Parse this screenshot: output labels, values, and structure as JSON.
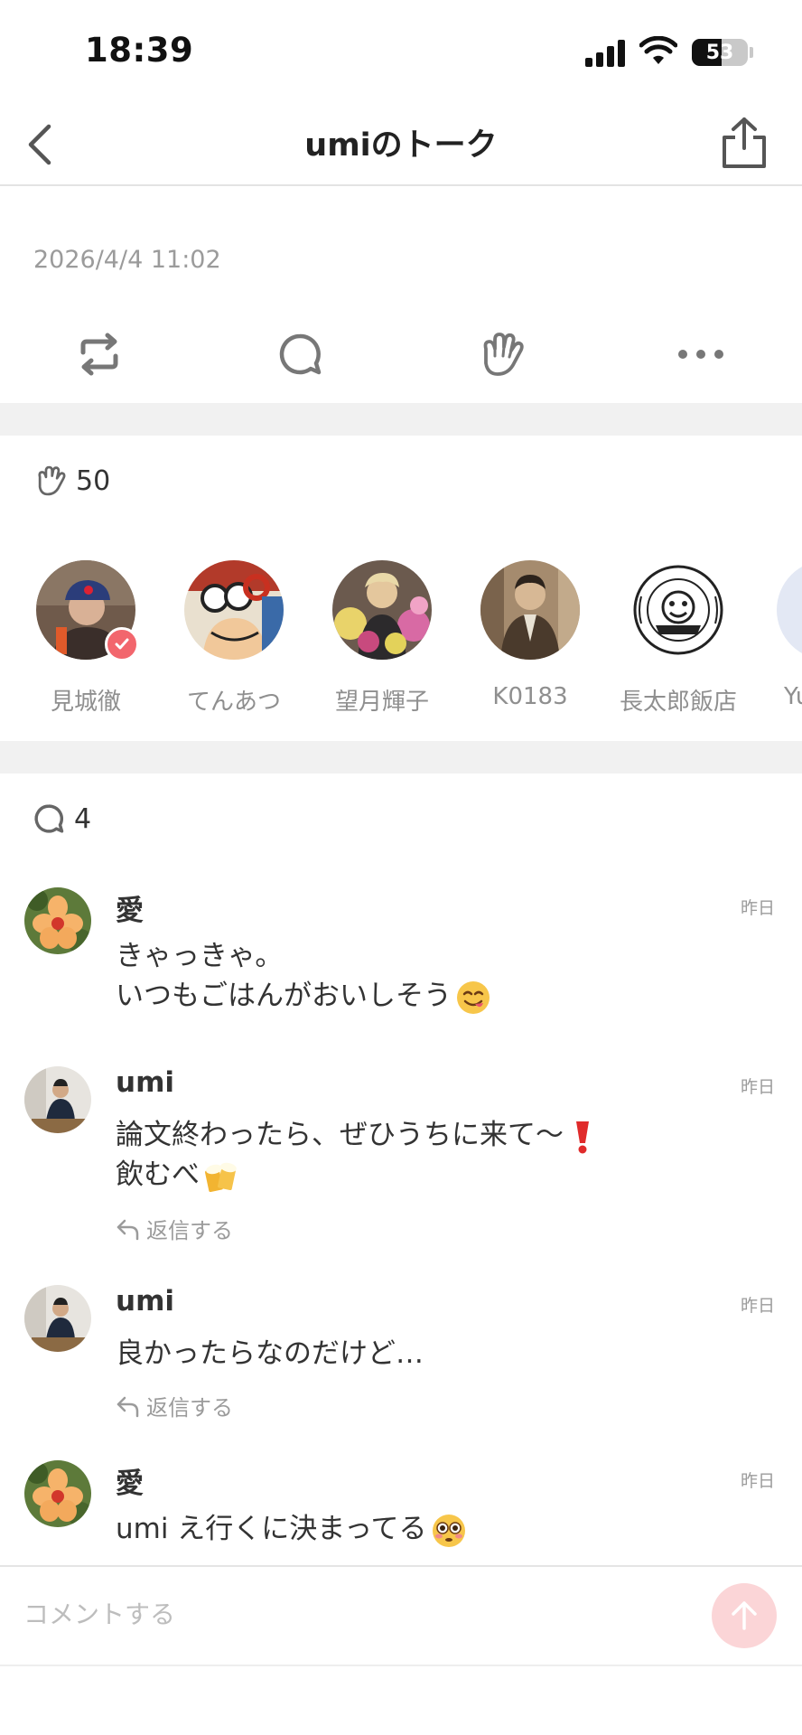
{
  "status_bar": {
    "time": "18:39",
    "battery": "53",
    "battery_level": 0.53
  },
  "header": {
    "title": "umiのトーク"
  },
  "post": {
    "date": "2026/4/4 11:02"
  },
  "claps": {
    "count": "50",
    "users": [
      {
        "name": "見城徹",
        "verified": true
      },
      {
        "name": "てんあつ"
      },
      {
        "name": "望月輝子"
      },
      {
        "name": "K0183"
      },
      {
        "name": "長太郎飯店"
      },
      {
        "name": "Yu"
      }
    ]
  },
  "comments": {
    "count": "4",
    "reply_label": "返信する",
    "items": [
      {
        "author": "愛",
        "time": "昨日",
        "line1": "きゃっきゃ。",
        "line2": "いつもごはんがおいしそう"
      },
      {
        "author": "umi",
        "time": "昨日",
        "line1": "論文終わったら、ぜひうちに来て〜",
        "line2": "飲むべ"
      },
      {
        "author": "umi",
        "time": "昨日",
        "line1": "良かったらなのだけど…"
      },
      {
        "author": "愛",
        "time": "昨日",
        "line1": "umi え行くに決まってる"
      }
    ]
  },
  "composer": {
    "placeholder": "コメントする"
  },
  "colors": {
    "accent": "#f2666d",
    "send_button": "#fbd5d7",
    "band": "#f1f1f1"
  }
}
